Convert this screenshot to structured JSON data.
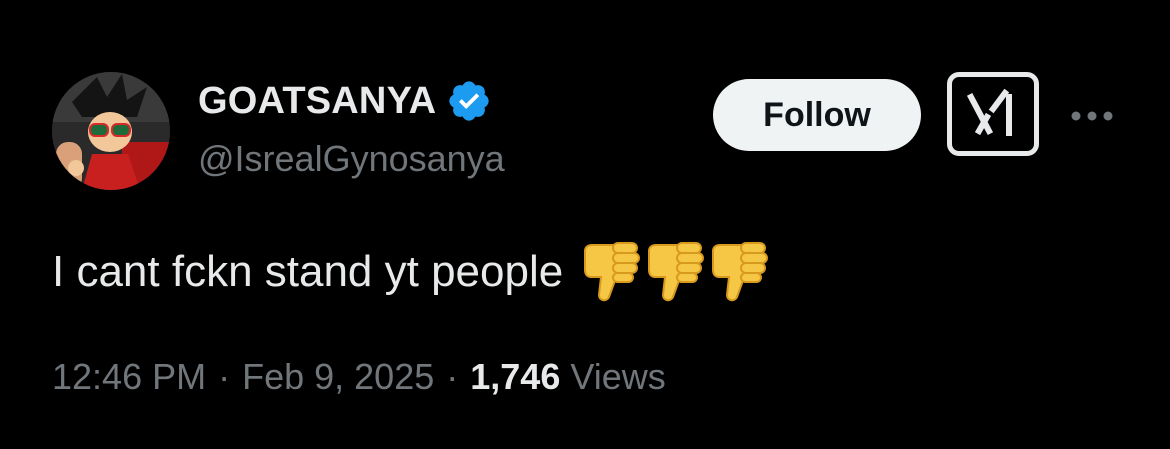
{
  "author": {
    "display_name": "GOATSANYA",
    "handle": "@IsrealGynosanya",
    "verified": true
  },
  "actions": {
    "follow_label": "Follow",
    "grok_icon": "grok-icon",
    "more_icon": "more-icon"
  },
  "tweet": {
    "text": "I cant fckn stand yt people",
    "emojis": [
      "thumbs-down-emoji",
      "thumbs-down-emoji",
      "thumbs-down-emoji"
    ]
  },
  "meta": {
    "time": "12:46 PM",
    "separator": "·",
    "date": "Feb 9, 2025",
    "views_count": "1,746",
    "views_label": "Views"
  },
  "colors": {
    "background": "#000000",
    "primary_text": "#e7e9ea",
    "secondary_text": "#71767b",
    "verified_blue": "#1d9bf0",
    "follow_bg": "#eff3f4",
    "emoji_yellow": "#f6c744"
  }
}
